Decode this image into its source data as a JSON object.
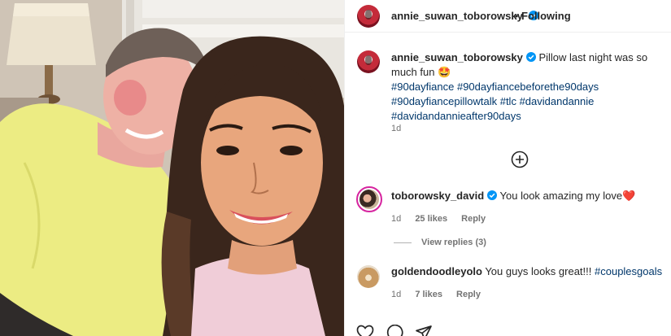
{
  "post": {
    "author": "annie_suwan_toborowsky",
    "follow_separator": "•",
    "follow_state": "Following",
    "caption_text": "Pillow last night was so much fun 🤩",
    "hashtags": [
      "#90dayfiance",
      "#90dayfiancebeforethe90days",
      "#90dayfiancepillowtalk",
      "#tlc",
      "#davidandannie",
      "#davidandannieafter90days"
    ],
    "caption_time": "1d"
  },
  "comments": [
    {
      "user": "toborowsky_david",
      "verified": true,
      "text": "You look amazing my love❤️",
      "time": "1d",
      "likes": "25 likes",
      "reply": "Reply",
      "view_replies": "View replies (3)"
    },
    {
      "user": "goldendoodleyolo",
      "verified": false,
      "text": "You guys looks great!!! ",
      "hashtag": "#couplesgoals",
      "time": "1d",
      "likes": "7 likes",
      "reply": "Reply"
    }
  ],
  "icons": {
    "load_more": "plus-circle-icon",
    "verified": "verified-badge-icon",
    "actions": [
      "heart-icon",
      "comment-icon",
      "share-icon"
    ]
  },
  "colors": {
    "link": "#00376b",
    "verified": "#0095f6",
    "muted": "#737373"
  }
}
